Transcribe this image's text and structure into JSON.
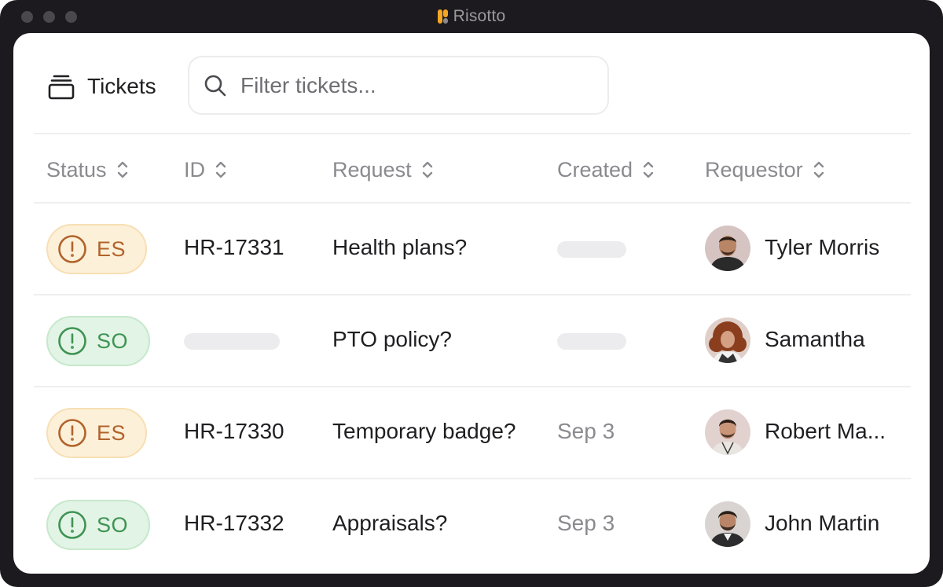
{
  "app": {
    "title": "Risotto"
  },
  "toolbar": {
    "tickets_label": "Tickets",
    "search_placeholder": "Filter tickets..."
  },
  "columns": [
    "Status",
    "ID",
    "Request",
    "Created",
    "Requestor"
  ],
  "colors": {
    "es_bg": "#fdf0d8",
    "es_text": "#b0632c",
    "so_bg": "#e2f4e5",
    "so_text": "#3f9353",
    "logo_orange": "#f5a623"
  },
  "rows": [
    {
      "status": "ES",
      "id": "HR-17331",
      "request": "Health plans?",
      "created": "",
      "requestor": "Tyler Morris"
    },
    {
      "status": "SO",
      "id": "",
      "request": "PTO policy?",
      "created": "",
      "requestor": "Samantha"
    },
    {
      "status": "ES",
      "id": "HR-17330",
      "request": "Temporary badge?",
      "created": "Sep 3",
      "requestor": "Robert Ma..."
    },
    {
      "status": "SO",
      "id": "HR-17332",
      "request": "Appraisals?",
      "created": "Sep 3",
      "requestor": "John Martin"
    }
  ]
}
